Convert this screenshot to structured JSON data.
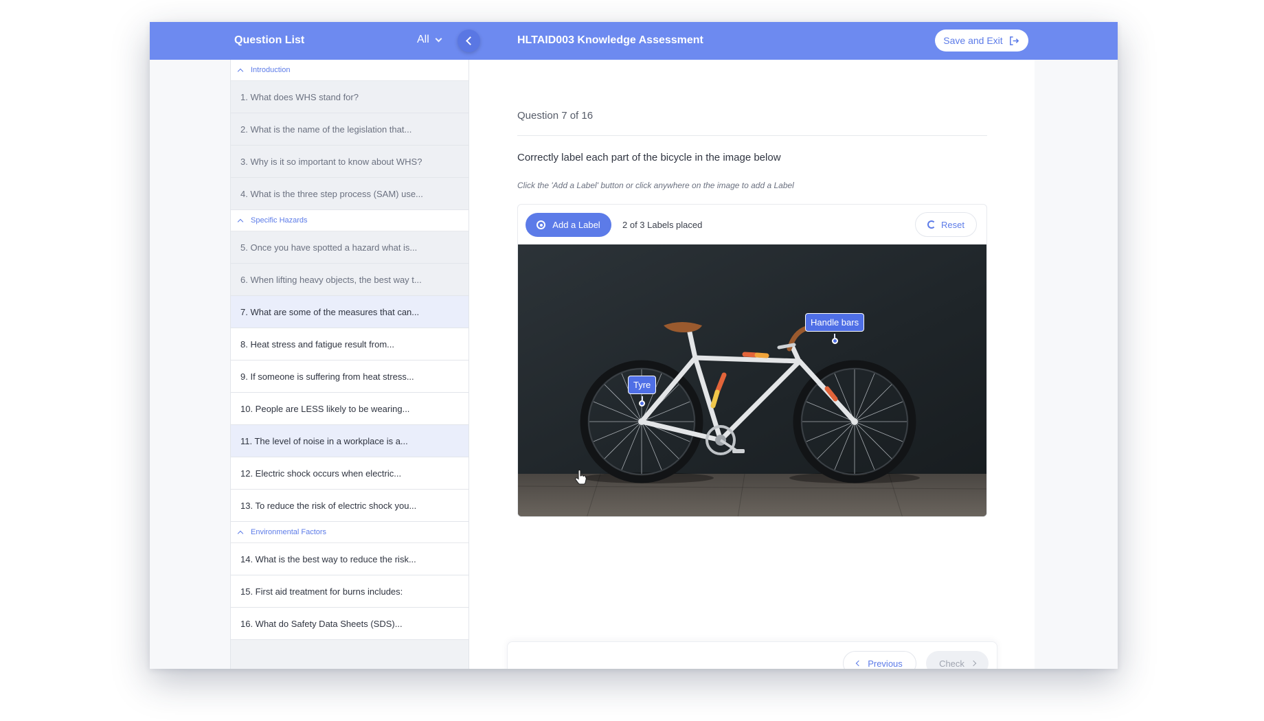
{
  "header": {
    "question_list_title": "Question List",
    "filter_value": "All",
    "course_title": "HLTAID003 Knowledge Assessment",
    "save_exit_label": "Save and Exit",
    "accent_color": "#6d8af0"
  },
  "sidebar": {
    "sections": [
      {
        "title": "Introduction",
        "items": [
          {
            "label": "1. What does WHS stand for?",
            "state": "done"
          },
          {
            "label": "2. What is the name of the legislation that...",
            "state": "done"
          },
          {
            "label": "3. Why is it so important to know about WHS?",
            "state": "done"
          },
          {
            "label": "4. What is the three step process (SAM) use...",
            "state": "done"
          }
        ]
      },
      {
        "title": "Specific Hazards",
        "items": [
          {
            "label": "5. Once you have spotted a hazard what is...",
            "state": "done"
          },
          {
            "label": "6. When lifting heavy objects, the best way t...",
            "state": "done"
          },
          {
            "label": "7. What are some of the measures that can...",
            "state": "active"
          },
          {
            "label": "8. Heat stress and fatigue result from...",
            "state": "todo"
          },
          {
            "label": "9. If someone is suffering from heat stress...",
            "state": "todo"
          },
          {
            "label": "10. People are LESS likely to be wearing...",
            "state": "todo"
          },
          {
            "label": "11. The level of noise in a workplace is a...",
            "state": "hover"
          },
          {
            "label": "12. Electric shock occurs when electric...",
            "state": "todo"
          },
          {
            "label": "13. To reduce the risk of electric shock you...",
            "state": "todo"
          }
        ]
      },
      {
        "title": "Environmental Factors",
        "items": [
          {
            "label": "14. What is the best way to reduce the risk...",
            "state": "todo"
          },
          {
            "label": "15. First aid treatment for burns includes:",
            "state": "todo"
          },
          {
            "label": "16. What do Safety Data Sheets (SDS)...",
            "state": "todo"
          }
        ]
      }
    ]
  },
  "question": {
    "number_text": "Question 7 of 16",
    "prompt": "Correctly label each part of the bicycle in the image below",
    "hint": "Click the 'Add a Label' button or click anywhere on the image to add a Label",
    "add_label_text": "Add a Label",
    "placed_status": "2 of 3 Labels placed",
    "reset_label": "Reset",
    "image_subject": "bicycle",
    "labels": [
      {
        "text": "Handle bars"
      },
      {
        "text": "Tyre"
      }
    ]
  },
  "footer": {
    "previous_label": "Previous",
    "check_label": "Check"
  }
}
